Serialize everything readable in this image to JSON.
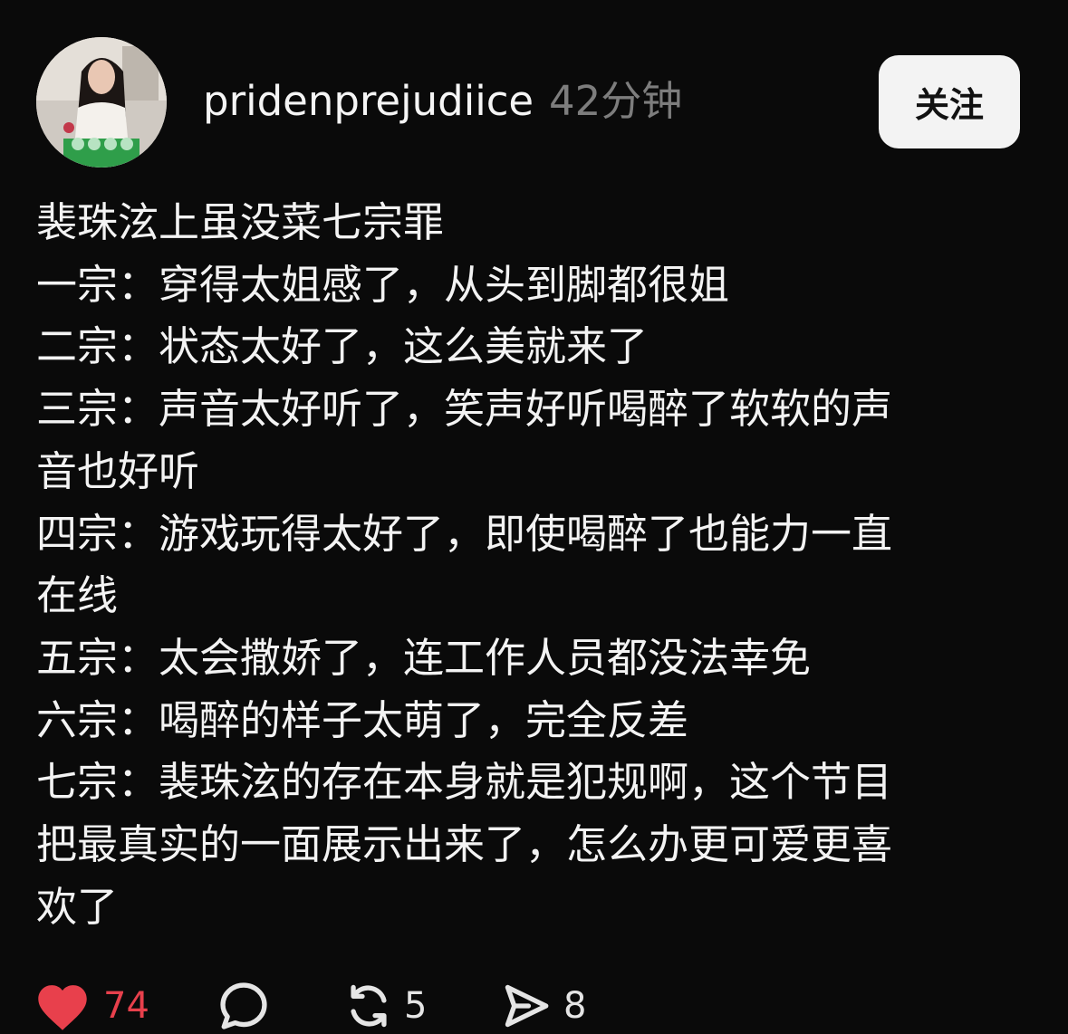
{
  "post": {
    "username": "pridenprejudiice",
    "time": "42分钟",
    "follow_label": "关注",
    "lines": [
      "裴珠泫上虽没菜七宗罪",
      "一宗：穿得太姐感了，从头到脚都很姐",
      "二宗：状态太好了，这么美就来了",
      "三宗：声音太好听了，笑声好听喝醉了软软的声",
      "音也好听",
      "四宗：游戏玩得太好了，即使喝醉了也能力一直",
      "在线",
      "五宗：太会撒娇了，连工作人员都没法幸免",
      "六宗：喝醉的样子太萌了，完全反差",
      "七宗：裴珠泫的存在本身就是犯规啊，这个节目",
      "把最真实的一面展示出来了，怎么办更可爱更喜",
      "欢了"
    ]
  },
  "actions": {
    "like": {
      "icon": "heart-filled-icon",
      "count": "74",
      "color": "#e8404c"
    },
    "comment": {
      "icon": "comment-bubble-icon"
    },
    "repost": {
      "icon": "repost-icon",
      "count": "5"
    },
    "share": {
      "icon": "send-icon",
      "count": "8"
    }
  },
  "colors": {
    "background": "#0a0a0a",
    "text": "#f3f3f3",
    "muted": "#7d7d7d",
    "button_bg": "#f3f3f3",
    "like": "#e8404c"
  }
}
